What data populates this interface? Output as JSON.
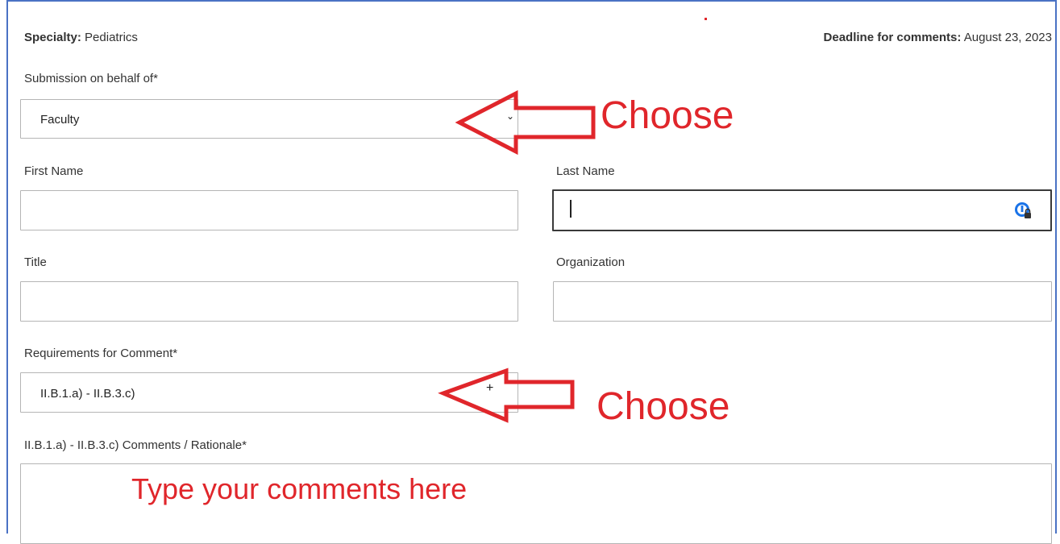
{
  "header": {
    "specialty_label": "Specialty:",
    "specialty_value": "Pediatrics",
    "deadline_label": "Deadline for comments:",
    "deadline_value": "August 23, 2023"
  },
  "form": {
    "submission_label": "Submission on behalf of*",
    "submission_value": "Faculty",
    "first_name_label": "First Name",
    "first_name_value": "",
    "last_name_label": "Last Name",
    "last_name_value": "",
    "title_label": "Title",
    "title_value": "",
    "organization_label": "Organization",
    "organization_value": "",
    "requirements_label": "Requirements for Comment*",
    "requirements_value": "II.B.1.a) - II.B.3.c)",
    "comments_label": "II.B.1.a) - II.B.3.c) Comments / Rationale*",
    "comments_value": ""
  },
  "annotations": {
    "choose_1": "Choose",
    "choose_2": "Choose",
    "type_comments": "Type your comments here",
    "color": "#e0262b"
  },
  "icons": {
    "dropdown": "chevron-down-icon",
    "add": "plus-icon",
    "password_manager": "password-manager-icon"
  }
}
